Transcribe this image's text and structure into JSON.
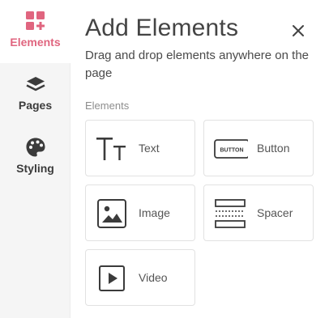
{
  "sidebar": {
    "items": [
      {
        "id": "elements",
        "label": "Elements",
        "icon": "grid-plus-icon",
        "active": true
      },
      {
        "id": "pages",
        "label": "Pages",
        "icon": "layers-icon",
        "active": false
      },
      {
        "id": "styling",
        "label": "Styling",
        "icon": "palette-icon",
        "active": false
      }
    ]
  },
  "panel": {
    "title": "Add Elements",
    "subtitle": "Drag and drop elements anywhere on the page",
    "close_icon": "close-icon",
    "section_label": "Elements",
    "elements": [
      {
        "label": "Text",
        "icon": "text-type-icon"
      },
      {
        "label": "Button",
        "icon": "button-icon",
        "icon_text": "BUTTON"
      },
      {
        "label": "Image",
        "icon": "image-icon"
      },
      {
        "label": "Spacer",
        "icon": "spacer-icon"
      },
      {
        "label": "Video",
        "icon": "video-icon"
      }
    ]
  },
  "colors": {
    "accent": "#e0657f",
    "rail_bg": "#f5f5f5",
    "icon_dark": "#3b3b3b",
    "card_border": "#e2e2e2"
  }
}
